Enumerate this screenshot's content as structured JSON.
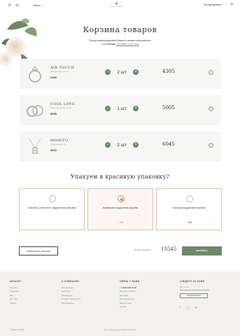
{
  "header": {
    "menu_label": "Меню",
    "logo_text": "ВЕЧНО ЖИВОЕ",
    "account_label": "Личный кабинет"
  },
  "page": {
    "title": "Корзина товаров",
    "subtitle_line1": "Перед подтверждением Вашего заказа ознакомьтесь",
    "subtitle_line2_prefix": "с условиями ",
    "subtitle_link": "Доставки и Оплаты"
  },
  "cart": {
    "items": [
      {
        "name": "AIR TOUCH",
        "desc": "Обручальное кольцо",
        "price": "2150",
        "qty": "2 шт",
        "sum": "4305"
      },
      {
        "name": "COOL LOVE",
        "desc": "Пара обручальных колец",
        "price": "5005",
        "qty": "1 шт",
        "sum": "5005"
      },
      {
        "name": "MOHITO",
        "desc": "Подвеска на цепи",
        "price": "3020",
        "qty": "2 шт",
        "sum": "6045"
      }
    ]
  },
  "packaging": {
    "title": "Упакуем в красивую упаковку?",
    "options": [
      {
        "label": "Спасибо, у меня есть подарочная упаковка",
        "price": ""
      },
      {
        "label": "Маленькая подарочная коробка",
        "price": "+ 205"
      },
      {
        "label": "Большая подарочная коробка",
        "price": "+ 305"
      }
    ]
  },
  "totals": {
    "back_label": "ПРОДОЛЖИТЬ ПОКУПКИ",
    "total_label": "Всего к оплате:",
    "total_value": "15545",
    "checkout_label": "ОФОРМИТЬ"
  },
  "footer": {
    "col1": {
      "heading": "КАТАЛОГ",
      "items": [
        "Колечки",
        "Подвески",
        "Все",
        "Для пар",
        "Серьги"
      ]
    },
    "col2": {
      "heading": "О КОМПАНИИ",
      "items": [
        "Об ювелирах",
        "Партнеры",
        "Инструкция",
        "Отзывы покупателей",
        "Сертификаты"
      ]
    },
    "col3": {
      "heading": "СВЯЗЬ С НАМИ",
      "items": [
        "+7 (999) 000-00-00",
        "Москва и область",
        "Доставка",
        "Восстановление",
        "Вопрос-ответ",
        "Оплата"
      ]
    },
    "col4": {
      "heading": "СЛЕДИТЕ ЗА НАМИ",
      "input_placeholder": "Ваш e-mail",
      "button_label": "ПОДПИСАТЬСЯ"
    },
    "copyright_left": "© ВЕЧНО ЖИВОЕ",
    "copyright_center": "Все права защищены. Вечно живое 2024"
  },
  "colors": {
    "accent_green": "#6d8a66",
    "accent_orange": "#e08a55"
  }
}
